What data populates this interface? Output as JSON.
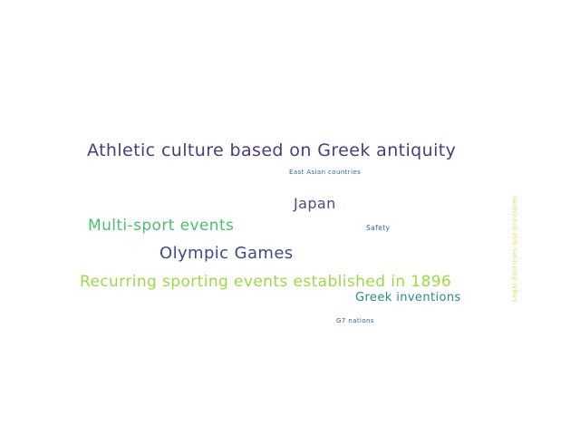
{
  "words": [
    {
      "text": "Athletic culture based on Greek antiquity",
      "color": "#4a3d7a"
    },
    {
      "text": "East Asian countries",
      "color": "#2f6b8e"
    },
    {
      "text": "Japan",
      "color": "#4a4c85"
    },
    {
      "text": "Multi-sport events",
      "color": "#4cbf6e"
    },
    {
      "text": "Safety",
      "color": "#2e6b8a"
    },
    {
      "text": "Olympic Games",
      "color": "#3f4a86"
    },
    {
      "text": "Recurring sporting events established in 1896",
      "color": "#9ed84a"
    },
    {
      "text": "Greek inventions",
      "color": "#2a8a8a"
    },
    {
      "text": "G7 nations",
      "color": "#3a5f8e"
    },
    {
      "text": "Legal doctrines and principles",
      "color": "#d8e06a"
    }
  ]
}
